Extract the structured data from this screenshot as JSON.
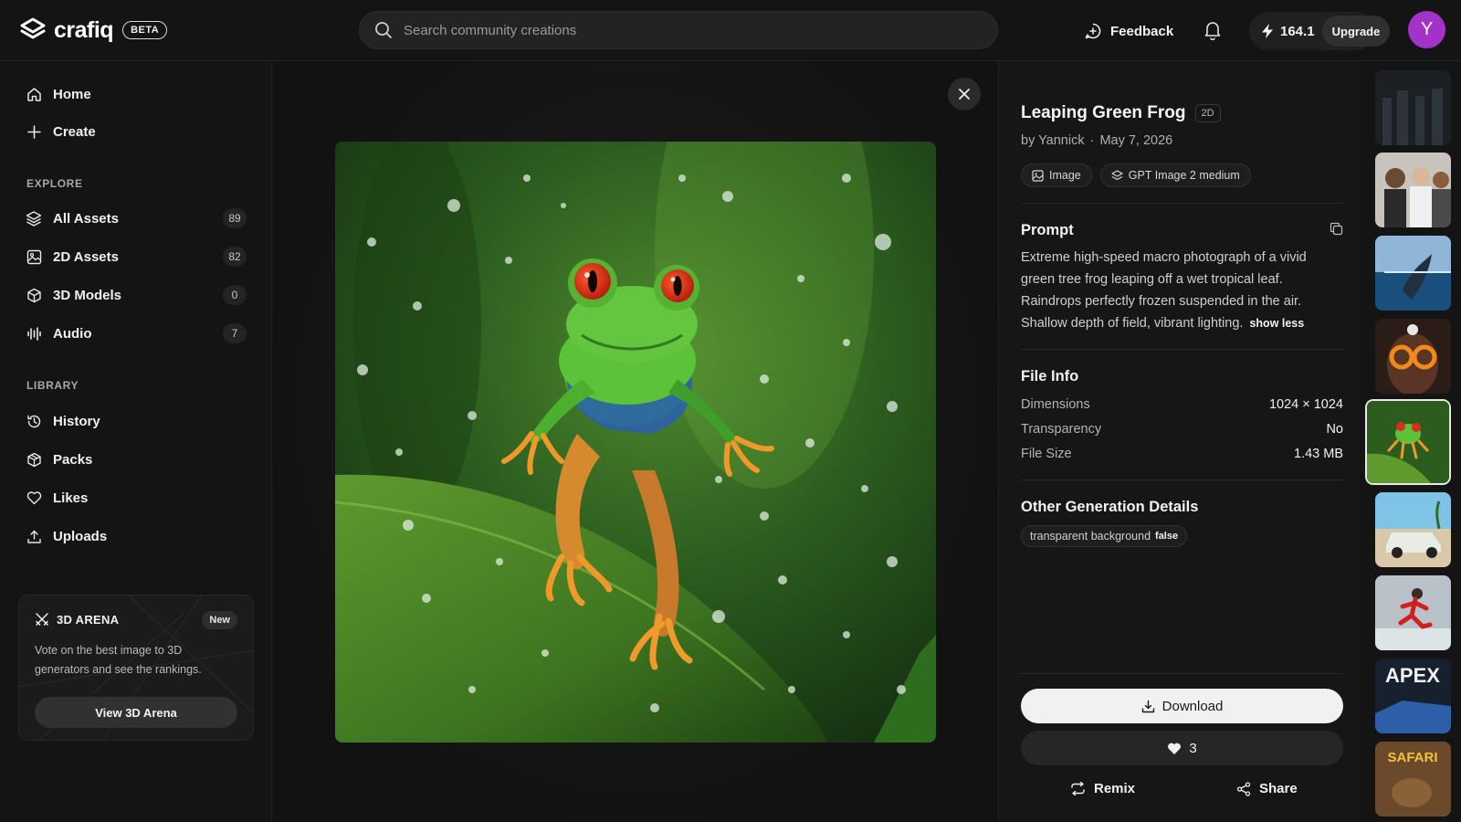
{
  "brand": {
    "name": "crafiq",
    "badge": "BETA"
  },
  "header": {
    "search_placeholder": "Search community creations",
    "feedback_label": "Feedback",
    "credits": "164.1",
    "upgrade_label": "Upgrade",
    "avatar_initial": "Y",
    "avatar_color": "#a332c8"
  },
  "sidebar": {
    "main": [
      {
        "label": "Home",
        "icon": "home-icon"
      },
      {
        "label": "Create",
        "icon": "plus-icon"
      }
    ],
    "explore_label": "EXPLORE",
    "explore": [
      {
        "label": "All Assets",
        "count": "89",
        "icon": "layers-icon"
      },
      {
        "label": "2D Assets",
        "count": "82",
        "icon": "image-icon"
      },
      {
        "label": "3D Models",
        "count": "0",
        "icon": "cube-icon"
      },
      {
        "label": "Audio",
        "count": "7",
        "icon": "waveform-icon"
      }
    ],
    "library_label": "LIBRARY",
    "library": [
      {
        "label": "History",
        "icon": "history-icon"
      },
      {
        "label": "Packs",
        "icon": "package-icon"
      },
      {
        "label": "Likes",
        "icon": "heart-icon"
      },
      {
        "label": "Uploads",
        "icon": "upload-icon"
      }
    ],
    "arena": {
      "title": "3D ARENA",
      "badge": "New",
      "description": "Vote on the best image to 3D generators and see the rankings.",
      "button_label": "View 3D Arena"
    }
  },
  "asset": {
    "title": "Leaping Green Frog",
    "type_tag": "2D",
    "author": "by Yannick",
    "date": "May 7, 2026",
    "chips": [
      {
        "label": "Image",
        "icon": "image-icon"
      },
      {
        "label": "GPT Image 2 medium",
        "icon": "model-icon"
      }
    ],
    "prompt_heading": "Prompt",
    "prompt_text": "Extreme high-speed macro photograph of a vivid green tree frog leaping off a wet tropical leaf. Raindrops perfectly frozen suspended in the air. Shallow depth of field, vibrant lighting.",
    "show_less_label": "show less",
    "file_info_heading": "File Info",
    "file_info": [
      {
        "key": "Dimensions",
        "value": "1024 × 1024"
      },
      {
        "key": "Transparency",
        "value": "No"
      },
      {
        "key": "File Size",
        "value": "1.43 MB"
      }
    ],
    "other_heading": "Other Generation Details",
    "other_detail": {
      "key": "transparent background",
      "value": "false"
    },
    "download_label": "Download",
    "likes": "3",
    "remix_label": "Remix",
    "share_label": "Share"
  },
  "thumbnails": [
    {
      "subject": "dark figures",
      "active": false
    },
    {
      "subject": "group of people",
      "active": false
    },
    {
      "subject": "whale in ocean",
      "active": false
    },
    {
      "subject": "orange sunglasses portrait",
      "active": false
    },
    {
      "subject": "leaping frog",
      "active": true
    },
    {
      "subject": "car on beach",
      "active": false
    },
    {
      "subject": "runner",
      "active": false
    },
    {
      "subject": "APEX racing",
      "active": false
    },
    {
      "subject": "SAFARI poster",
      "active": false
    }
  ]
}
